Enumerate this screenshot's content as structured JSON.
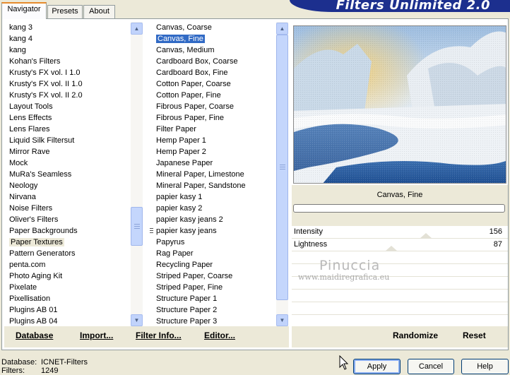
{
  "tabs": [
    {
      "label": "Navigator",
      "active": true
    },
    {
      "label": "Presets",
      "active": false
    },
    {
      "label": "About",
      "active": false
    }
  ],
  "banner_title": "Filters Unlimited 2.0",
  "categories": [
    "kang 3",
    "kang 4",
    "kang",
    "Kohan's Filters",
    "Krusty's FX vol. I 1.0",
    "Krusty's FX vol. II 1.0",
    "Krusty's FX vol. II 2.0",
    "Layout Tools",
    "Lens Effects",
    "Lens Flares",
    "Liquid Silk Filtersut",
    "Mirror Rave",
    "Mock",
    "MuRa's Seamless",
    "Neology",
    "Nirvana",
    "Noise Filters",
    "Oliver's Filters",
    "Paper Backgrounds",
    "Paper Textures",
    "Pattern Generators",
    "penta.com",
    "Photo Aging Kit",
    "Pixelate",
    "Pixellisation",
    "Plugins AB 01",
    "Plugins AB 04"
  ],
  "selected_category": "Paper Textures",
  "filters": [
    "Canvas, Coarse",
    "Canvas, Fine",
    "Canvas, Medium",
    "Cardboard Box, Coarse",
    "Cardboard Box, Fine",
    "Cotton Paper, Coarse",
    "Cotton Paper, Fine",
    "Fibrous Paper, Coarse",
    "Fibrous Paper, Fine",
    "Filter Paper",
    "Hemp Paper 1",
    "Hemp Paper 2",
    "Japanese Paper",
    "Mineral Paper, Limestone",
    "Mineral Paper, Sandstone",
    "papier kasy 1",
    "papier kasy 2",
    "papier kasy jeans 2",
    "papier kasy jeans",
    "Papyrus",
    "Rag Paper",
    "Recycling Paper",
    "Striped Paper, Coarse",
    "Striped Paper, Fine",
    "Structure Paper 1",
    "Structure Paper 2",
    "Structure Paper 3"
  ],
  "selected_filter": "Canvas, Fine",
  "preview": {
    "filter_name": "Canvas, Fine"
  },
  "sliders": [
    {
      "label": "Intensity",
      "value": "156",
      "level": 156
    },
    {
      "label": "Lightness",
      "value": "87",
      "level": 87
    }
  ],
  "watermark": {
    "name": "Pinuccia",
    "site": "www.maidiregrafica.eu"
  },
  "toolbar": {
    "database": "Database",
    "import": "Import...",
    "filter_info": "Filter Info...",
    "editor": "Editor...",
    "randomize": "Randomize",
    "reset": "Reset"
  },
  "status": {
    "database_label": "Database:",
    "database_value": "ICNET-Filters",
    "filters_label": "Filters:",
    "filters_value": "1249"
  },
  "dialog_buttons": {
    "apply": "Apply",
    "cancel": "Cancel",
    "help": "Help"
  },
  "colors": {
    "selection": "#316ac5",
    "banner": "#1c2f8e",
    "tab_highlight": "#e68b2c"
  }
}
